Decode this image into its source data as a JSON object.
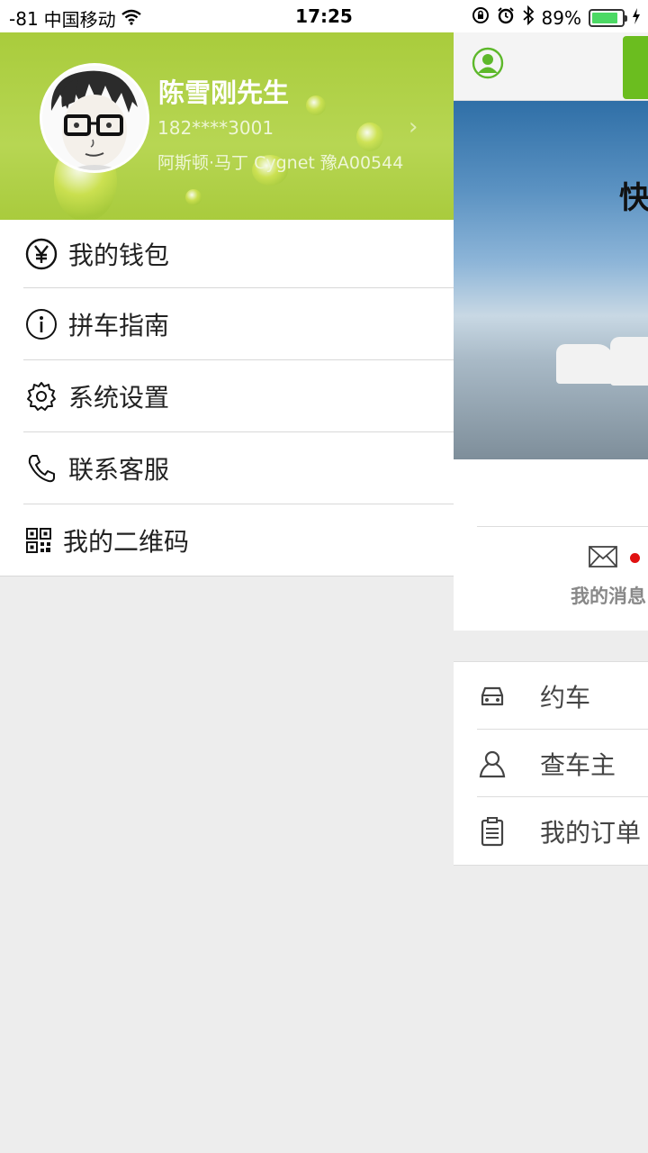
{
  "status_bar": {
    "signal": "-81",
    "carrier": "中国移动",
    "time": "17:25",
    "battery": "89%",
    "battery_level": 0.89
  },
  "profile": {
    "name": "陈雪刚先生",
    "phone": "182****3001",
    "car": "阿斯顿·马丁 Cygnet 豫A00544",
    "chevron": "›"
  },
  "menu": [
    {
      "icon": "yuan-icon",
      "label": "我的钱包"
    },
    {
      "icon": "info-icon",
      "label": "拼车指南"
    },
    {
      "icon": "gear-icon",
      "label": "系统设置"
    },
    {
      "icon": "phone-icon",
      "label": "联系客服"
    },
    {
      "icon": "qrcode-icon",
      "label": "我的二维码"
    }
  ],
  "main": {
    "banner_text": "快",
    "message_label": "我的消息",
    "list": [
      {
        "icon": "car-icon",
        "label": "约车"
      },
      {
        "icon": "person-icon",
        "label": "查车主"
      },
      {
        "icon": "clipboard-icon",
        "label": "我的订单"
      }
    ]
  },
  "colors": {
    "profile_green": "#a9cc3c",
    "accent_green": "#6bbd1f",
    "badge_red": "#e01010"
  }
}
